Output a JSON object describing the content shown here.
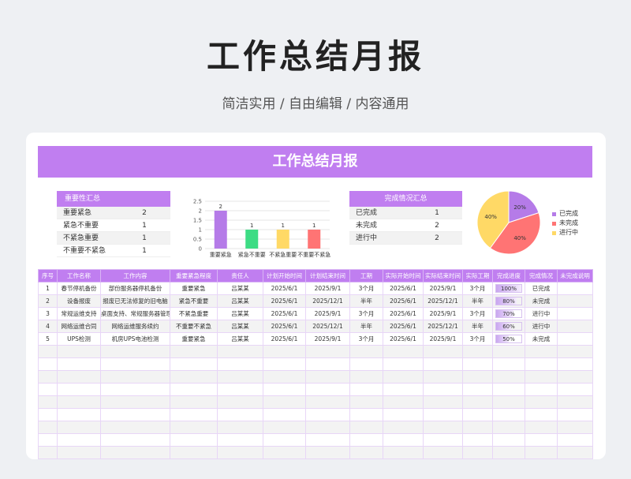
{
  "hero": {
    "title": "工作总结月报",
    "subtitle": "简洁实用 / 自由编辑 / 内容通用"
  },
  "sheet": {
    "title": "工作总结月报"
  },
  "importance": {
    "header": "重要性汇总",
    "rows": [
      {
        "label": "重要紧急",
        "value": "2"
      },
      {
        "label": "紧急不重要",
        "value": "1"
      },
      {
        "label": "不紧急重要",
        "value": "1"
      },
      {
        "label": "不重要不紧急",
        "value": "1"
      }
    ]
  },
  "completion": {
    "header": "完成情况汇总",
    "rows": [
      {
        "label": "已完成",
        "value": "1"
      },
      {
        "label": "未完成",
        "value": "2"
      },
      {
        "label": "进行中",
        "value": "2"
      }
    ]
  },
  "chart_data": [
    {
      "type": "bar",
      "categories": [
        "重要紧急",
        "紧急不重要",
        "不紧急重要",
        "不重要不紧急"
      ],
      "values": [
        2,
        1,
        1,
        1
      ],
      "colors": [
        "#b57be8",
        "#3ddc84",
        "#ffd966",
        "#ff7474"
      ],
      "yticks": [
        "0",
        "0.5",
        "1",
        "1.5",
        "2",
        "2.5"
      ],
      "ylim": [
        0,
        2.5
      ],
      "grid": true
    },
    {
      "type": "pie",
      "categories": [
        "已完成",
        "未完成",
        "进行中"
      ],
      "values": [
        20,
        40,
        40
      ],
      "labels": [
        "20%",
        "40%",
        "40%"
      ],
      "colors": [
        "#b57be8",
        "#ff7474",
        "#ffd966"
      ],
      "legend": "right"
    }
  ],
  "table": {
    "headers": [
      "序号",
      "工作名称",
      "工作内容",
      "重要紧急程度",
      "责任人",
      "计划开始时间",
      "计划结束时间",
      "工期",
      "实际开始时间",
      "实际结束时间",
      "实际工期",
      "完成进度",
      "完成情况",
      "未完成说明"
    ],
    "rows": [
      [
        "1",
        "春节停机备份",
        "部份服务器停机备份",
        "重要紧急",
        "吕某某",
        "2025/6/1",
        "2025/9/1",
        "3个月",
        "2025/6/1",
        "2025/9/1",
        "3个月",
        "100%",
        "已完成",
        ""
      ],
      [
        "2",
        "设备报废",
        "报废已无法修复的旧电脑",
        "紧急不重要",
        "吕某某",
        "2025/6/1",
        "2025/12/1",
        "半年",
        "2025/6/1",
        "2025/12/1",
        "半年",
        "80%",
        "未完成",
        ""
      ],
      [
        "3",
        "常规运维支持",
        "桌面支持、常规服务器管理",
        "不紧急重要",
        "吕某某",
        "2025/6/1",
        "2025/9/1",
        "3个月",
        "2025/6/1",
        "2025/9/1",
        "3个月",
        "70%",
        "进行中",
        ""
      ],
      [
        "4",
        "网络运维合同",
        "网络运维服务续约",
        "不重要不紧急",
        "吕某某",
        "2025/6/1",
        "2025/12/1",
        "半年",
        "2025/6/1",
        "2025/12/1",
        "半年",
        "60%",
        "进行中",
        ""
      ],
      [
        "5",
        "UPS检测",
        "机房UPS电池检测",
        "重要紧急",
        "吕某某",
        "2025/6/1",
        "2025/9/1",
        "3个月",
        "2025/6/1",
        "2025/9/1",
        "3个月",
        "50%",
        "未完成",
        ""
      ]
    ],
    "progress": [
      1.0,
      0.8,
      0.7,
      0.6,
      0.5
    ],
    "empty_rows": 9
  },
  "colors": {
    "accent": "#c07ef0",
    "background": "#eef0f3"
  }
}
